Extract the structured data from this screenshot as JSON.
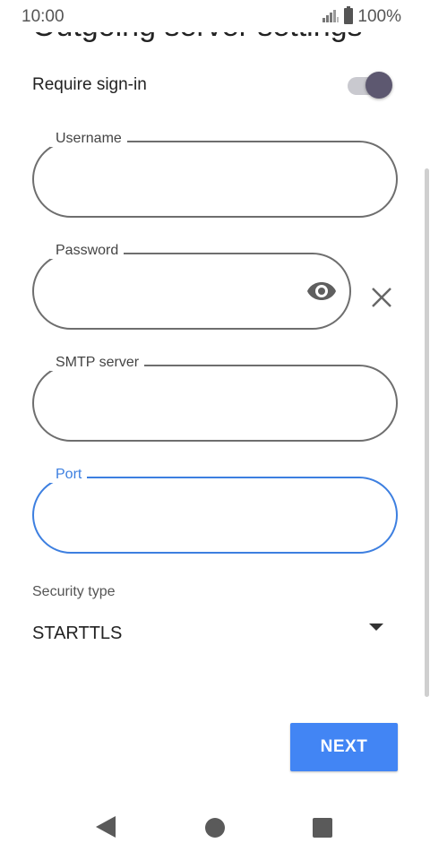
{
  "status_bar": {
    "time": "10:00",
    "battery": "100%",
    "icons": [
      "signal-icon",
      "battery-icon"
    ]
  },
  "header": {
    "clipped_title": "Outgoing server settings"
  },
  "toggle": {
    "label": "Require sign-in",
    "on": true
  },
  "fields": {
    "username": {
      "label": "Username",
      "value": ""
    },
    "password": {
      "label": "Password",
      "value": ""
    },
    "smtp_server": {
      "label": "SMTP server",
      "value": ""
    },
    "port": {
      "label": "Port",
      "value": "",
      "focused": true
    }
  },
  "security": {
    "label": "Security type",
    "value": "STARTTLS"
  },
  "actions": {
    "next_label": "NEXT"
  },
  "colors": {
    "accent": "#3d7fe0",
    "button": "#4285f4",
    "toggle_thumb": "#5d5870"
  }
}
